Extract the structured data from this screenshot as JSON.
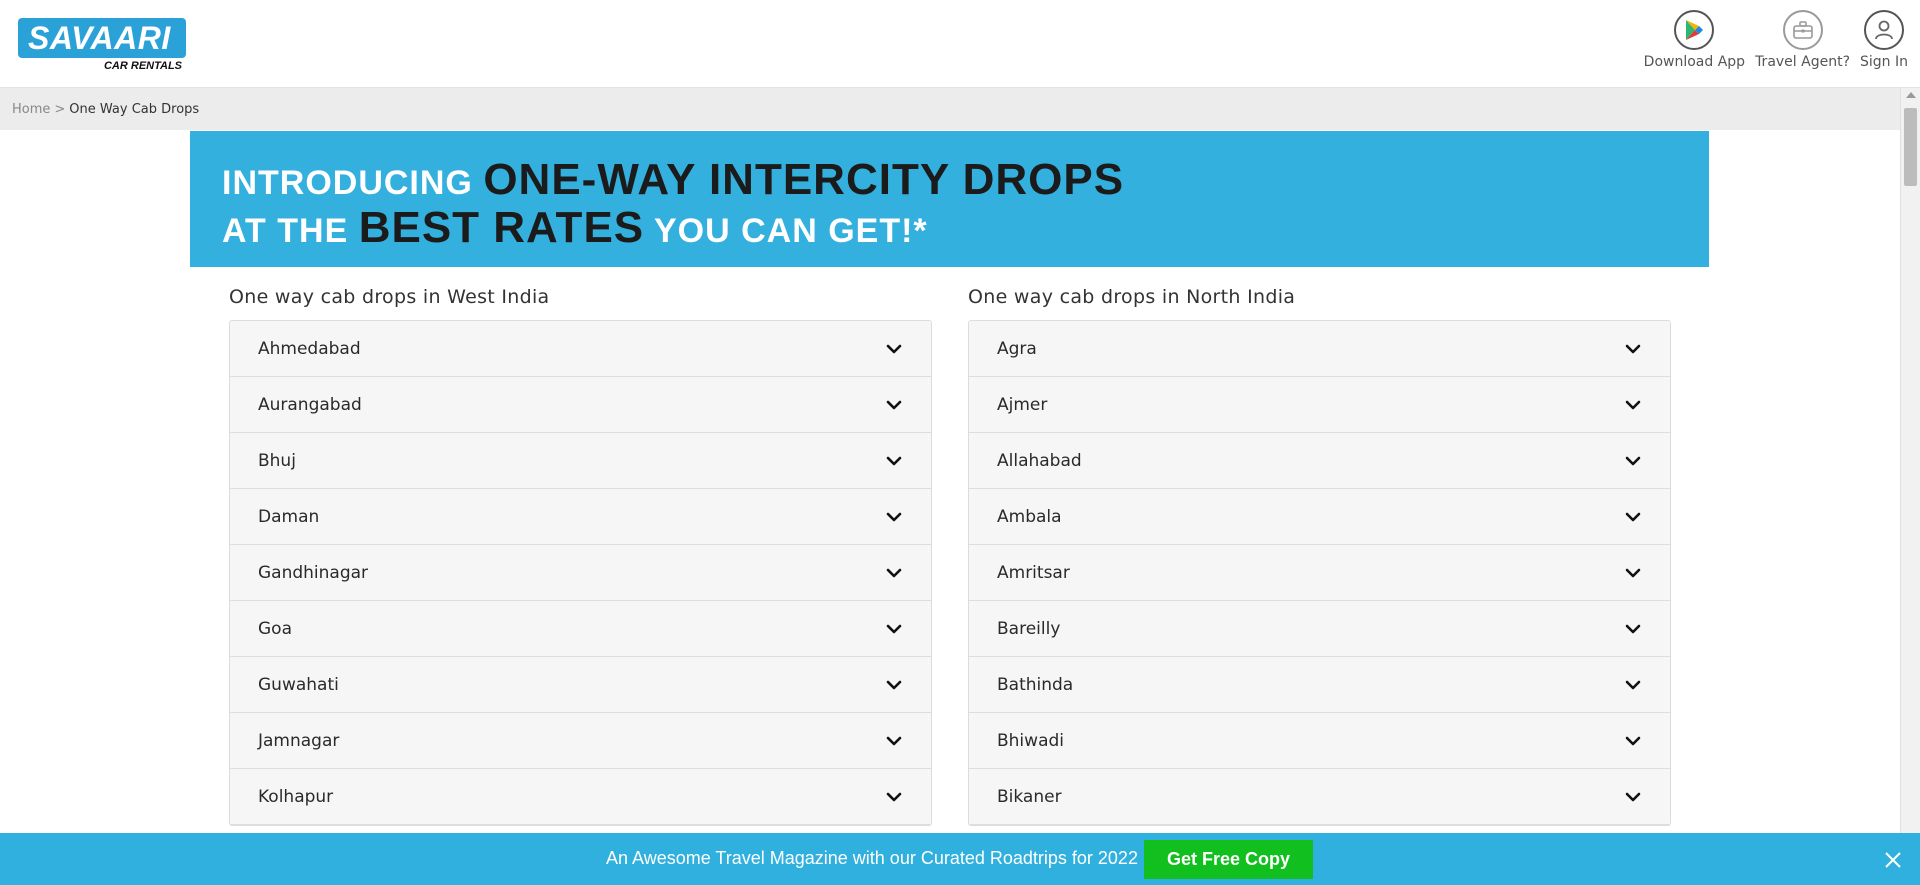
{
  "brand": {
    "name": "SAVAARI",
    "tagline": "CAR RENTALS"
  },
  "header": {
    "actions": [
      {
        "label": "Download App",
        "icon": "play-store-icon"
      },
      {
        "label": "Travel Agent?",
        "icon": "briefcase-icon"
      },
      {
        "label": "Sign In",
        "icon": "user-icon"
      }
    ]
  },
  "breadcrumb": {
    "home": "Home",
    "separator": ">",
    "current": "One Way Cab Drops"
  },
  "banner": {
    "line1_a": "INTRODUCING ",
    "line1_b": "ONE-WAY INTERCITY DROPS",
    "line2_a": "AT THE ",
    "line2_b": "BEST RATES",
    "line2_c": " YOU CAN GET!*"
  },
  "west": {
    "title": "One way cab drops in West India",
    "cities": [
      "Ahmedabad",
      "Aurangabad",
      "Bhuj",
      "Daman",
      "Gandhinagar",
      "Goa",
      "Guwahati",
      "Jamnagar",
      "Kolhapur"
    ]
  },
  "north": {
    "title": "One way cab drops in North India",
    "cities": [
      "Agra",
      "Ajmer",
      "Allahabad",
      "Ambala",
      "Amritsar",
      "Bareilly",
      "Bathinda",
      "Bhiwadi",
      "Bikaner"
    ]
  },
  "promo": {
    "text": "An Awesome Travel Magazine with our Curated Roadtrips for 2022",
    "button": "Get Free Copy"
  },
  "colors": {
    "brand_blue": "#2aa2d8",
    "banner_blue": "#34b0df",
    "cta_green": "#11bf1e"
  }
}
